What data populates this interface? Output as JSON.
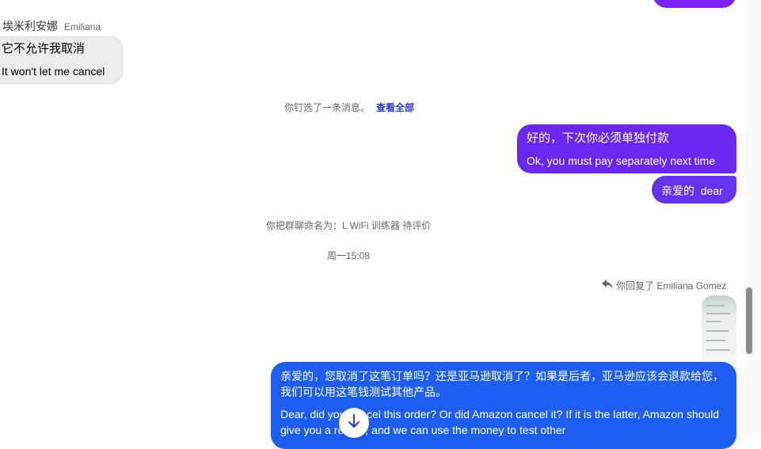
{
  "incoming": {
    "sender_name_cn": "埃米利安娜",
    "sender_name_en": "Emiliana",
    "line_cn": "它不允许我取消",
    "line_en": "It won't let me cancel"
  },
  "pinned_notice": {
    "text": "你钉选了一条消息。",
    "link": "查看全部"
  },
  "outgoing_1": {
    "line_cn": "好的，下次你必须单独付款",
    "line_en": "Ok, you must pay separately next time"
  },
  "outgoing_2": {
    "text": "亲爱的  dear"
  },
  "rename_notice": "你把群聊命名为：L WiFi 训练器 待评价",
  "timestamp": "周一15:08",
  "reply_note": "你回复了 Emiliana Gomez",
  "outgoing_3": {
    "para_cn": "亲爱的，您取消了这笔订单吗？还是亚马逊取消了？如果是后者，亚马逊应该会退款给您，我们可以用这笔钱测试其他产品。",
    "para_en": "Dear, did you cancel this order? Or did Amazon cancel it? If it is the latter, Amazon should give you a refund, and we can use the money to test other"
  },
  "colors": {
    "outgoing_purple": "#6a27f0",
    "outgoing_blue": "#1f5ef2",
    "incoming_gray": "#ececec",
    "link": "#2b3bd1"
  },
  "icons": {
    "reply": "reply-arrow-icon",
    "scroll": "arrow-down-icon"
  }
}
